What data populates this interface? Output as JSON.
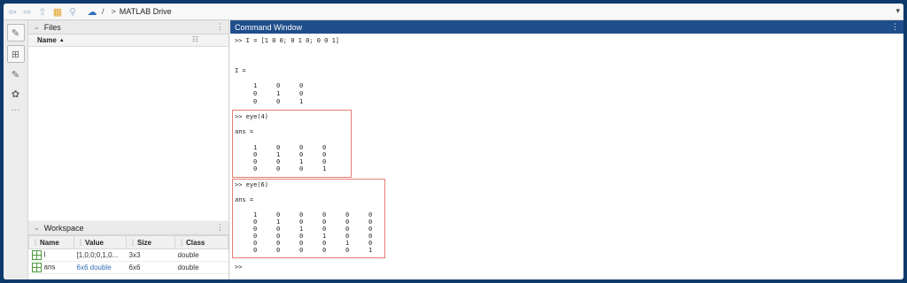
{
  "toolbar": {
    "path_root": "/",
    "path_sep": ">",
    "path_item": "MATLAB Drive",
    "dropdown_glyph": "▾"
  },
  "files_panel": {
    "title": "Files",
    "column_name": "Name",
    "sort_glyph": "▲"
  },
  "workspace_panel": {
    "title": "Workspace",
    "columns": [
      "Name",
      "Value",
      "Size",
      "Class"
    ],
    "rows": [
      {
        "name": "I",
        "value": "[1,0,0;0,1,0...",
        "size": "3x3",
        "class": "double"
      },
      {
        "name": "ans",
        "value": "6x6 double",
        "size": "6x6",
        "class": "double"
      }
    ]
  },
  "command_window": {
    "title": "Command Window",
    "cmd1": ">> I = [1 0 0; 0 1 0; 0 0 1]",
    "var1": "I =",
    "matrix_I": [
      [
        "1",
        "0",
        "0"
      ],
      [
        "0",
        "1",
        "0"
      ],
      [
        "0",
        "0",
        "1"
      ]
    ],
    "cmd2": ">> eye(4)",
    "ans_label": "ans =",
    "matrix_eye4": [
      [
        "1",
        "0",
        "0",
        "0"
      ],
      [
        "0",
        "1",
        "0",
        "0"
      ],
      [
        "0",
        "0",
        "1",
        "0"
      ],
      [
        "0",
        "0",
        "0",
        "1"
      ]
    ],
    "cmd3": ">> eye(6)",
    "matrix_eye6": [
      [
        "1",
        "0",
        "0",
        "0",
        "0",
        "0"
      ],
      [
        "0",
        "1",
        "0",
        "0",
        "0",
        "0"
      ],
      [
        "0",
        "0",
        "1",
        "0",
        "0",
        "0"
      ],
      [
        "0",
        "0",
        "0",
        "1",
        "0",
        "0"
      ],
      [
        "0",
        "0",
        "0",
        "0",
        "1",
        "0"
      ],
      [
        "0",
        "0",
        "0",
        "0",
        "0",
        "1"
      ]
    ],
    "prompt": ">>",
    "highlight_color": "#e47d73"
  },
  "colors": {
    "accent": "#1f4e8c",
    "frame": "#0d3a6b"
  }
}
